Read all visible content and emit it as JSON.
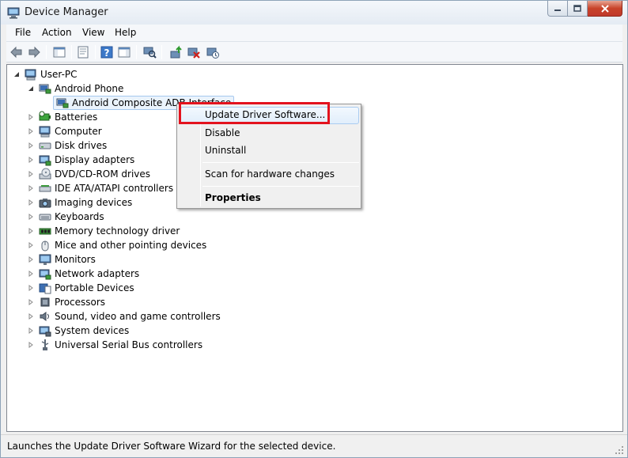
{
  "window": {
    "title": "Device Manager",
    "icon": "device-manager-icon"
  },
  "menubar": {
    "items": [
      "File",
      "Action",
      "View",
      "Help"
    ]
  },
  "toolbar": {
    "icons": [
      "back-arrow-icon",
      "forward-arrow-icon",
      "show-hide-console-tree-icon",
      "properties-icon",
      "help-icon",
      "show-action-pane-icon",
      "scan-hardware-icon",
      "update-driver-icon",
      "uninstall-icon",
      "disable-device-icon"
    ]
  },
  "tree": {
    "root": "User-PC",
    "android_phone": "Android Phone",
    "selected_child": "Android Composite ADB Interface",
    "categories": [
      "Batteries",
      "Computer",
      "Disk drives",
      "Display adapters",
      "DVD/CD-ROM drives",
      "IDE ATA/ATAPI controllers",
      "Imaging devices",
      "Keyboards",
      "Memory technology driver",
      "Mice and other pointing devices",
      "Monitors",
      "Network adapters",
      "Portable Devices",
      "Processors",
      "Sound, video and game controllers",
      "System devices",
      "Universal Serial Bus controllers"
    ]
  },
  "context_menu": {
    "update_driver": "Update Driver Software...",
    "disable": "Disable",
    "uninstall": "Uninstall",
    "scan": "Scan for hardware changes",
    "properties": "Properties"
  },
  "statusbar": {
    "text": "Launches the Update Driver Software Wizard for the selected device."
  },
  "colors": {
    "highlight_box": "#e3131e",
    "selection_bg": "#eaf3fc",
    "selection_border": "#a6c8ee"
  }
}
